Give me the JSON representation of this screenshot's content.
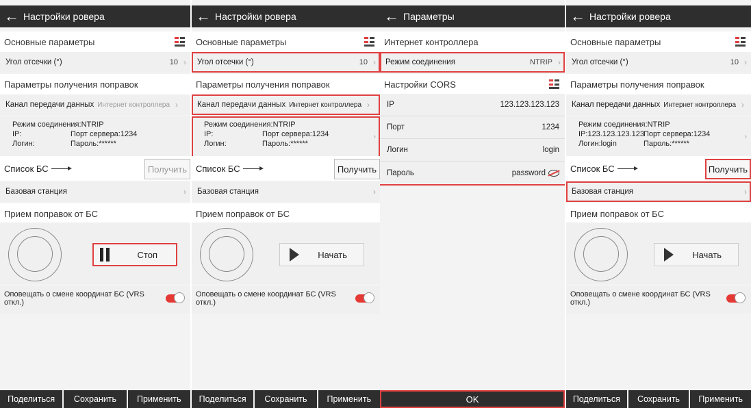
{
  "panel1": {
    "title": "Настройки ровера",
    "basic_section": "Основные параметры",
    "cutoff_label": "Угол отсечки (°)",
    "cutoff_value": "10",
    "corrections_section": "Параметры получения поправок",
    "channel_label": "Канал передачи данных",
    "channel_value": "Интернет контроллера",
    "mode": "Режим соединения:NTRIP",
    "ip": "IP:",
    "port": "Порт сервера:1234",
    "login": "Логин:",
    "password": "Пароль:******",
    "bs_list": "Список БС",
    "get_button": "Получить",
    "base_station": "Базовая станция",
    "receive_section": "Прием поправок от БС",
    "action_button": "Стоп",
    "notify_text": "Оповещать о смене координат БС (VRS откл.)",
    "share": "Поделиться",
    "save": "Сохранить",
    "apply": "Применить"
  },
  "panel2": {
    "title": "Настройки ровера",
    "basic_section": "Основные параметры",
    "cutoff_label": "Угол отсечки (°)",
    "cutoff_value": "10",
    "corrections_section": "Параметры получения поправок",
    "channel_label": "Канал передачи данных",
    "channel_value": "Интернет контроллера",
    "mode": "Режим соединения:NTRIP",
    "ip": "IP:",
    "port": "Порт сервера:1234",
    "login": "Логин:",
    "password": "Пароль:******",
    "bs_list": "Список БС",
    "get_button": "Получить",
    "base_station": "Базовая станция",
    "receive_section": "Прием поправок от БС",
    "action_button": "Начать",
    "notify_text": "Оповещать о смене координат БС (VRS откл.)",
    "share": "Поделиться",
    "save": "Сохранить",
    "apply": "Применить"
  },
  "panel3": {
    "title": "Параметры",
    "internet_section": "Интернет контроллера",
    "conn_mode_label": "Режим соединения",
    "conn_mode_value": "NTRIP",
    "cors_section": "Настройки CORS",
    "ip_label": "IP",
    "ip_value": "123.123.123.123",
    "port_label": "Порт",
    "port_value": "1234",
    "login_label": "Логин",
    "login_value": "login",
    "password_label": "Пароль",
    "password_value": "password",
    "ok": "OK"
  },
  "panel4": {
    "title": "Настройки ровера",
    "basic_section": "Основные параметры",
    "cutoff_label": "Угол отсечки (°)",
    "cutoff_value": "10",
    "corrections_section": "Параметры получения поправок",
    "channel_label": "Канал передачи данных",
    "channel_value": "Интернет контроллера",
    "mode": "Режим соединения:NTRIP",
    "ip": "IP:123.123.123.123",
    "port": "Порт сервера:1234",
    "login": "Логин:login",
    "password": "Пароль:******",
    "bs_list": "Список БС",
    "get_button": "Получить",
    "base_station": "Базовая станция",
    "receive_section": "Прием поправок от БС",
    "action_button": "Начать",
    "notify_text": "Оповещать о смене координат БС (VRS откл.)",
    "share": "Поделиться",
    "save": "Сохранить",
    "apply": "Применить"
  },
  "colors": {
    "header": "#2e2e2e",
    "accent_red": "#e04040",
    "toggle_on": "#e53935"
  }
}
